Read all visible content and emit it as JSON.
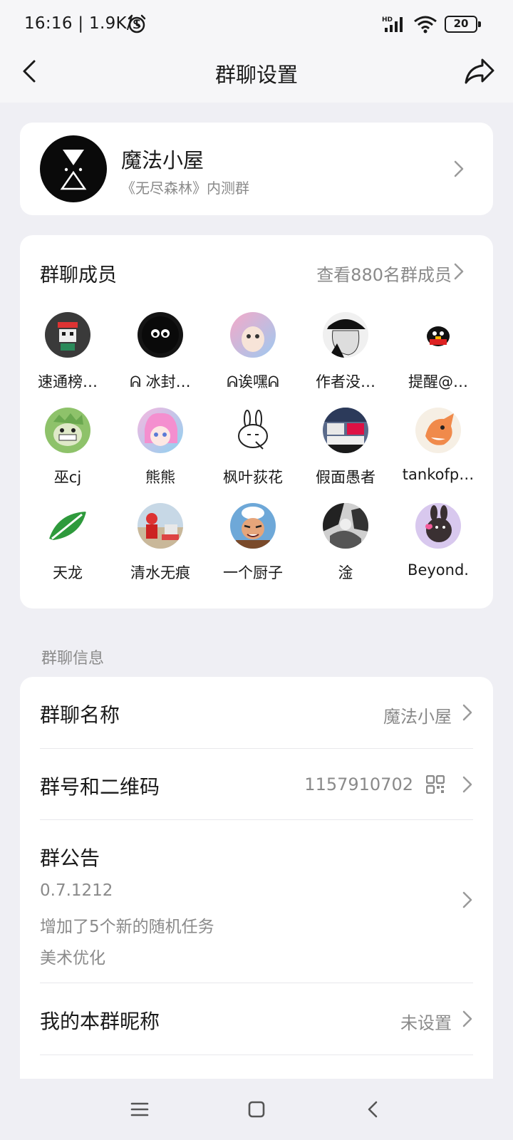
{
  "status": {
    "time": "16:16 | 1.9K/s",
    "battery": "20"
  },
  "nav": {
    "title": "群聊设置"
  },
  "group": {
    "name": "魔法小屋",
    "desc": "《无尽森林》内测群"
  },
  "members": {
    "title": "群聊成员",
    "link": "查看880名群成员",
    "list": [
      {
        "name": "速通榜…"
      },
      {
        "name": "ᕱ 冰封…"
      },
      {
        "name": "ᕱ诶嘿ᕱ"
      },
      {
        "name": "作者没…"
      },
      {
        "name": "提醒@…"
      },
      {
        "name": "巫cj"
      },
      {
        "name": "熊熊"
      },
      {
        "name": "枫叶荻花"
      },
      {
        "name": "假面愚者"
      },
      {
        "name": "tankofp…"
      },
      {
        "name": "天龙"
      },
      {
        "name": "清水无痕"
      },
      {
        "name": "一个厨子"
      },
      {
        "name": "淦"
      },
      {
        "name": "Beyond."
      }
    ]
  },
  "info": {
    "section_label": "群聊信息",
    "group_name_label": "群聊名称",
    "group_name_value": "魔法小屋",
    "group_id_label": "群号和二维码",
    "group_id_value": "1157910702",
    "notice_label": "群公告",
    "notice_lines": [
      "0.7.1212",
      "增加了5个新的随机任务",
      "美术优化"
    ],
    "nickname_label": "我的本群昵称",
    "nickname_value": "未设置"
  },
  "colors": {
    "background": "#EFEFF4",
    "card": "#FFFFFF",
    "secondary_text": "#8A8A8A"
  }
}
